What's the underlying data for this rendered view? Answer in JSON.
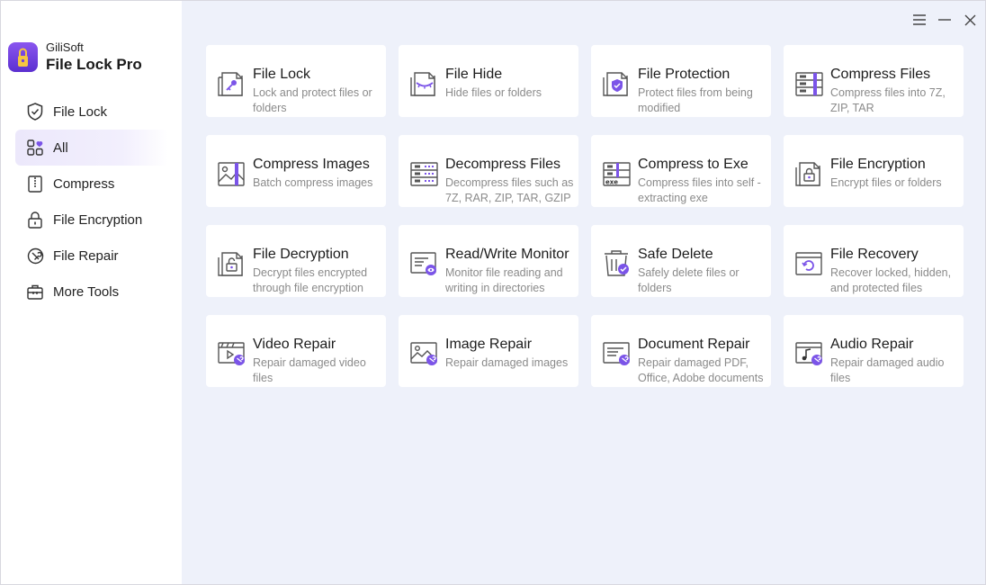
{
  "brand": {
    "vendor": "GiliSoft",
    "product": "File Lock Pro"
  },
  "colors": {
    "accent": "#7b54e8",
    "sidebar_active_bg": "#ece8fb",
    "main_bg": "#eef1fa",
    "icon_gray": "#555555"
  },
  "window_controls": {
    "menu_icon": "menu-icon",
    "minimize_icon": "minimize-icon",
    "close_icon": "close-icon"
  },
  "nav": [
    {
      "label": "File Lock",
      "icon": "shield-icon",
      "active": false
    },
    {
      "label": "All",
      "icon": "grid-icon",
      "active": true
    },
    {
      "label": "Compress",
      "icon": "zip-icon",
      "active": false
    },
    {
      "label": "File Encryption",
      "icon": "lock-icon",
      "active": false
    },
    {
      "label": "File Repair",
      "icon": "repair-icon",
      "active": false
    },
    {
      "label": "More Tools",
      "icon": "toolbox-icon",
      "active": false
    }
  ],
  "tools": [
    {
      "title": "File Lock",
      "desc": "Lock and protect files or folders",
      "icon": "file-lock-icon"
    },
    {
      "title": "File Hide",
      "desc": "Hide files or folders",
      "icon": "file-hide-icon"
    },
    {
      "title": "File Protection",
      "desc": "Protect files from being modified",
      "icon": "file-protection-icon"
    },
    {
      "title": "Compress Files",
      "desc": "Compress files into 7Z, ZIP, TAR",
      "icon": "compress-files-icon"
    },
    {
      "title": "Compress Images",
      "desc": "Batch compress images",
      "icon": "compress-images-icon"
    },
    {
      "title": "Decompress Files",
      "desc": "Decompress files such as 7Z, RAR, ZIP, TAR, GZIP",
      "icon": "decompress-files-icon"
    },
    {
      "title": "Compress to Exe",
      "desc": "Compress files into self - extracting exe",
      "icon": "compress-exe-icon"
    },
    {
      "title": "File Encryption",
      "desc": "Encrypt files or folders",
      "icon": "file-encryption-icon"
    },
    {
      "title": "File Decryption",
      "desc": "Decrypt files encrypted through file encryption",
      "icon": "file-decryption-icon"
    },
    {
      "title": "Read/Write Monitor",
      "desc": "Monitor file reading and writing in directories",
      "icon": "monitor-icon"
    },
    {
      "title": "Safe Delete",
      "desc": "Safely delete files or folders",
      "icon": "trash-icon"
    },
    {
      "title": "File Recovery",
      "desc": "Recover locked, hidden, and protected files",
      "icon": "file-recovery-icon"
    },
    {
      "title": "Video Repair",
      "desc": "Repair damaged video files",
      "icon": "video-repair-icon"
    },
    {
      "title": "Image Repair",
      "desc": "Repair damaged images",
      "icon": "image-repair-icon"
    },
    {
      "title": "Document Repair",
      "desc": "Repair damaged PDF, Office, Adobe documents",
      "icon": "document-repair-icon"
    },
    {
      "title": "Audio Repair",
      "desc": "Repair damaged audio files",
      "icon": "audio-repair-icon"
    }
  ]
}
